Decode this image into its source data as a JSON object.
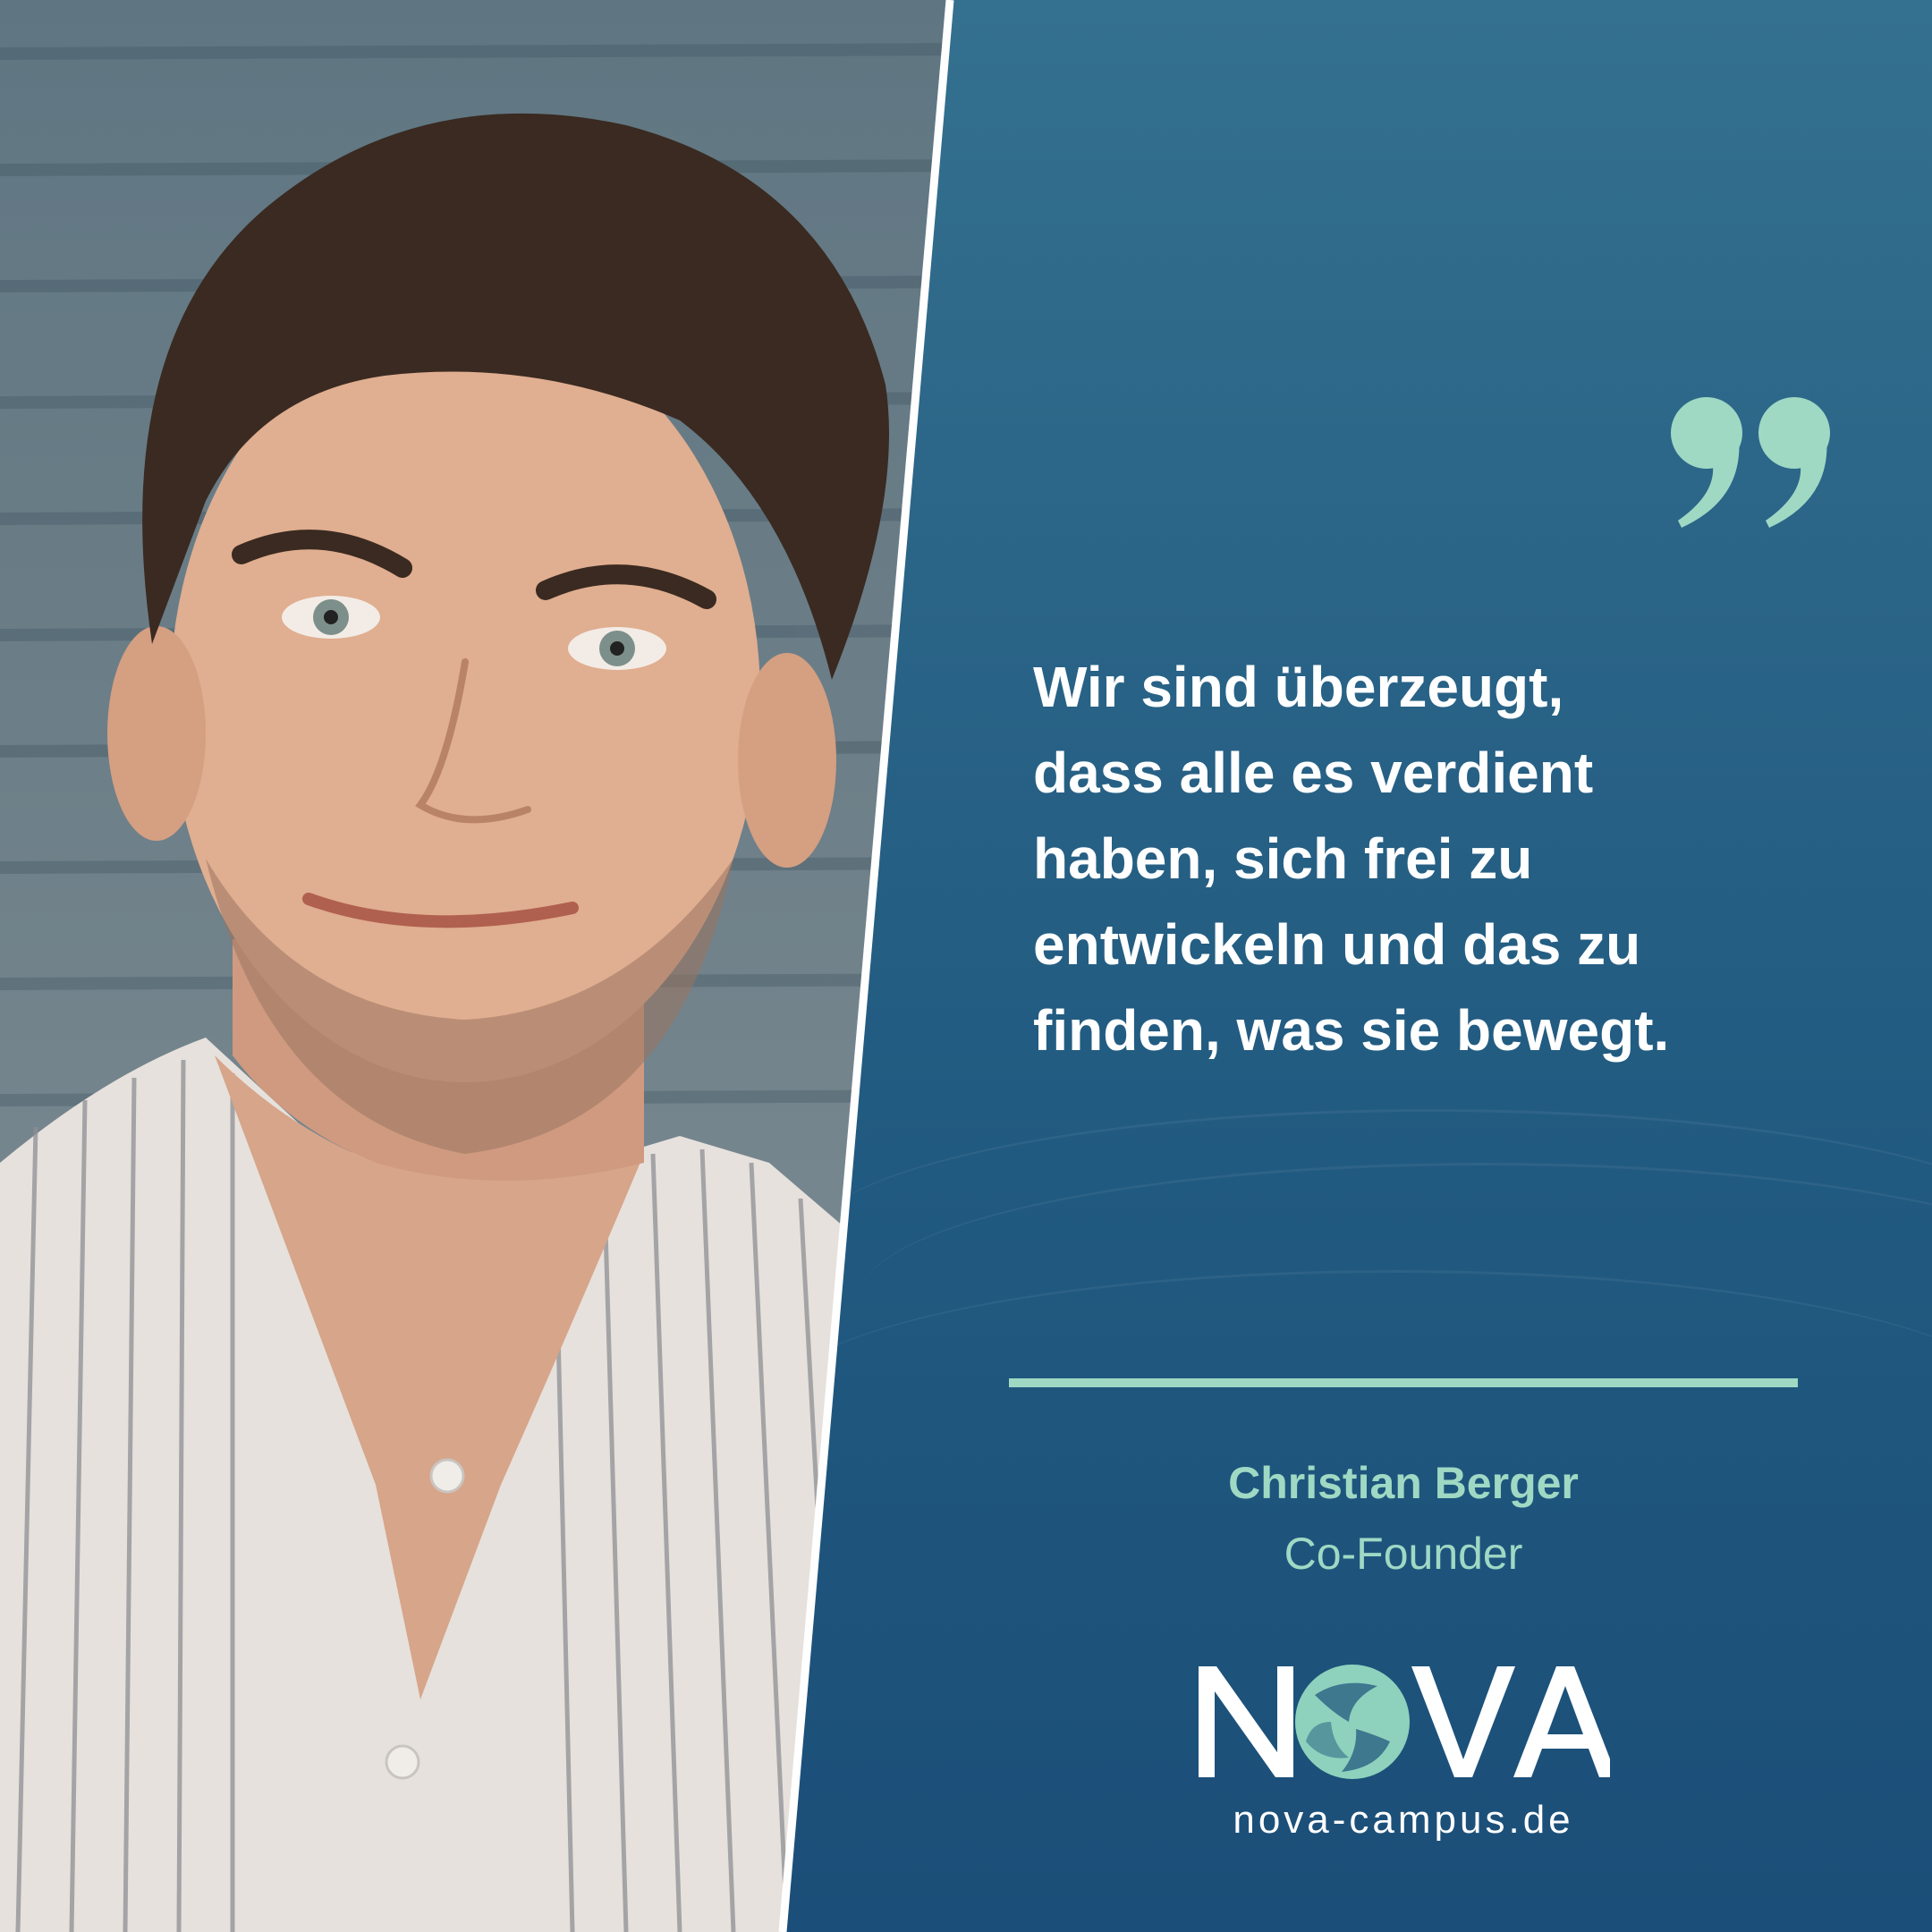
{
  "quote": {
    "lines": [
      "Wir sind überzeugt,",
      "dass alle es verdient",
      "haben, sich frei zu",
      "entwickeln und das zu",
      "finden, was sie bewegt."
    ]
  },
  "author": {
    "name": "Christian Berger",
    "role": "Co-Founder"
  },
  "brand": {
    "logo_text": "NOVA",
    "url": "nova-campus.de"
  },
  "colors": {
    "accent": "#9fd9c4",
    "panel": "#215a80",
    "text": "#ffffff"
  },
  "icons": {
    "quote": "closing-quote-icon",
    "logo": "nova-logo"
  }
}
